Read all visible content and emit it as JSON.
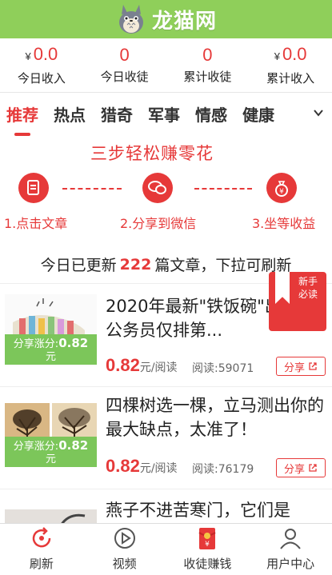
{
  "app": {
    "logo_text": "龙猫网"
  },
  "stats": [
    {
      "currency": "¥",
      "value": "0.0",
      "label": "今日收入"
    },
    {
      "currency": "",
      "value": "0",
      "label": "今日收徒"
    },
    {
      "currency": "",
      "value": "0",
      "label": "累计收徒"
    },
    {
      "currency": "¥",
      "value": "0.0",
      "label": "累计收入"
    }
  ],
  "tabs": [
    "推荐",
    "热点",
    "猎奇",
    "军事",
    "情感",
    "健康"
  ],
  "promo": {
    "title": "三步轻松赚零花",
    "steps": [
      "1.点击文章",
      "2.分享到微信",
      "3.坐等收益"
    ]
  },
  "notice": {
    "prefix": "今日已更新",
    "count": "222",
    "suffix": "篇文章，下拉可刷新"
  },
  "newbie": {
    "label": "新手必读"
  },
  "articles": [
    {
      "title": "2020年最新\"铁饭碗\"出炉！公务员仅排第...",
      "share_prefix": "分享涨分:",
      "share_value": "0.82",
      "share_unit": "元",
      "price": "0.82",
      "price_unit": "元/阅读",
      "reads": "阅读:59071",
      "share_label": "分享"
    },
    {
      "title": "四棵树选一棵，立马测出你的最大缺点，太准了！",
      "share_prefix": "分享涨分:",
      "share_value": "0.82",
      "share_unit": "元",
      "price": "0.82",
      "price_unit": "元/阅读",
      "reads": "阅读:76179",
      "share_label": "分享"
    },
    {
      "title": "燕子不进苦寒门，它们是"
    }
  ],
  "bottom_nav": [
    {
      "label": "刷新",
      "icon": "refresh-icon"
    },
    {
      "label": "视频",
      "icon": "play-icon"
    },
    {
      "label": "收徒赚钱",
      "icon": "red-envelope-icon"
    },
    {
      "label": "用户中心",
      "icon": "user-icon"
    }
  ],
  "colors": {
    "brand_green": "#8fcf5a",
    "accent_red": "#e63939",
    "badge_green": "#7cc65a"
  }
}
